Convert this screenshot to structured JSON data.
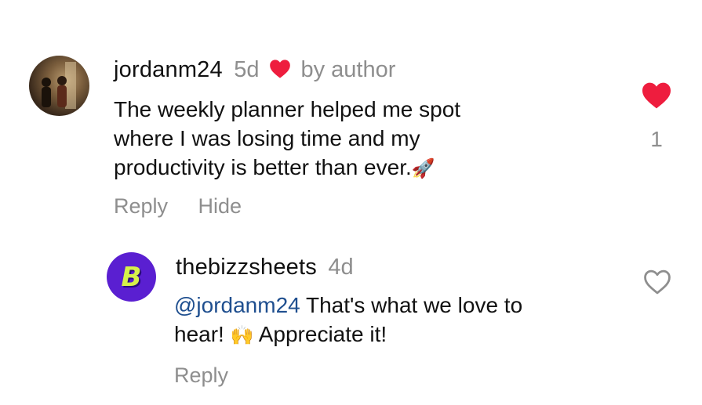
{
  "comment1": {
    "username": "jordanm24",
    "age": "5d",
    "author_badge": "by author",
    "text_lines": [
      "The weekly planner helped me spot",
      "where I was losing time and my",
      "productivity is better than ever."
    ],
    "emoji": "🚀",
    "like_count": "1",
    "liked": true,
    "actions": {
      "reply": "Reply",
      "hide": "Hide"
    },
    "avatar_icon": "user-photo"
  },
  "comment2": {
    "username": "thebizzsheets",
    "age": "4d",
    "mention": "@jordanm24",
    "text_line1": " That's what we love to",
    "text_line2_a": "hear! ",
    "emoji": "🙌",
    "text_line2_b": " Appreciate it!",
    "liked": false,
    "actions": {
      "reply": "Reply"
    },
    "avatar_letter": "B"
  },
  "colors": {
    "heart_red": "#ee1d3e",
    "muted": "#8e8e8e",
    "mention_blue": "#1f4f8f",
    "brand_purple": "#5a1fd1",
    "brand_lime": "#d6f24a"
  }
}
